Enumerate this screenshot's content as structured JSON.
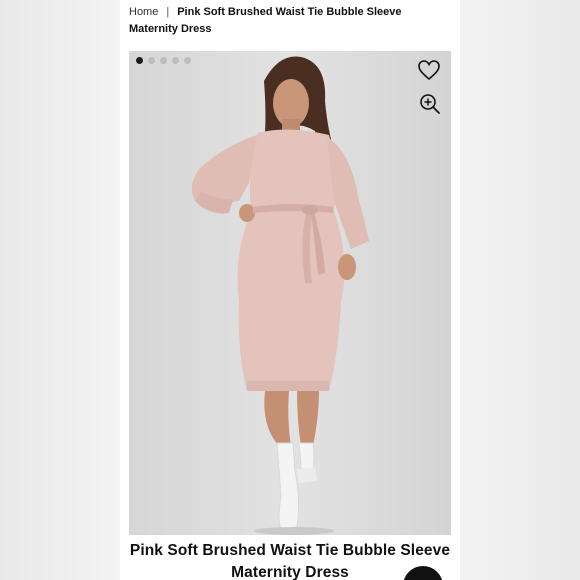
{
  "breadcrumb": {
    "home": "Home",
    "separator": "|",
    "current": "Pink Soft Brushed Waist Tie Bubble Sleeve Maternity Dress"
  },
  "gallery": {
    "image_count": 5,
    "active_index": 0,
    "icons": {
      "wishlist": "heart-icon",
      "zoom": "zoom-in-icon"
    }
  },
  "product": {
    "title": "Pink Soft Brushed Waist Tie Bubble Sleeve Maternity Dress"
  },
  "colors": {
    "background": "#f0f0f0",
    "dress": "#e3c3bc",
    "photo_bg": "#dcdcdc",
    "text": "#111111"
  }
}
